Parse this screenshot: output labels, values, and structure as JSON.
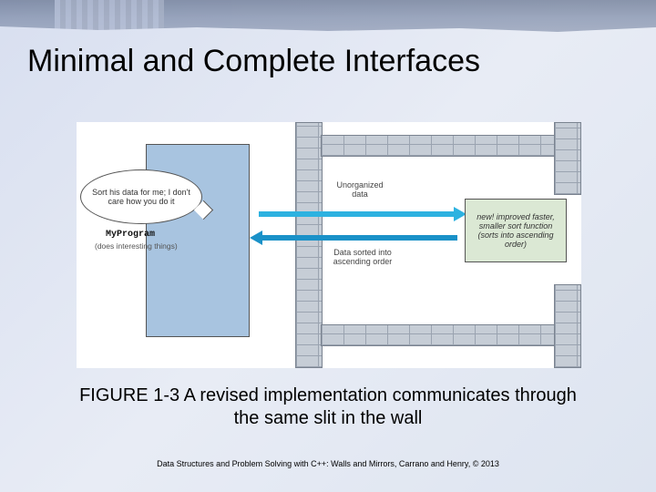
{
  "title": "Minimal and Complete Interfaces",
  "diagram": {
    "speech": "Sort his data for me; I don't care how you do it",
    "program_name": "MyProgram",
    "program_sub": "(does interesting things)",
    "unorganized": "Unorganized data",
    "sorted": "Data sorted into ascending order",
    "sort_box": "new! improved faster, smaller sort function (sorts into ascending order)"
  },
  "caption": "FIGURE 1-3 A revised implementation communicates through the same slit in the wall",
  "footer": "Data Structures and Problem Solving with C++: Walls and Mirrors, Carrano and Henry, © 2013"
}
